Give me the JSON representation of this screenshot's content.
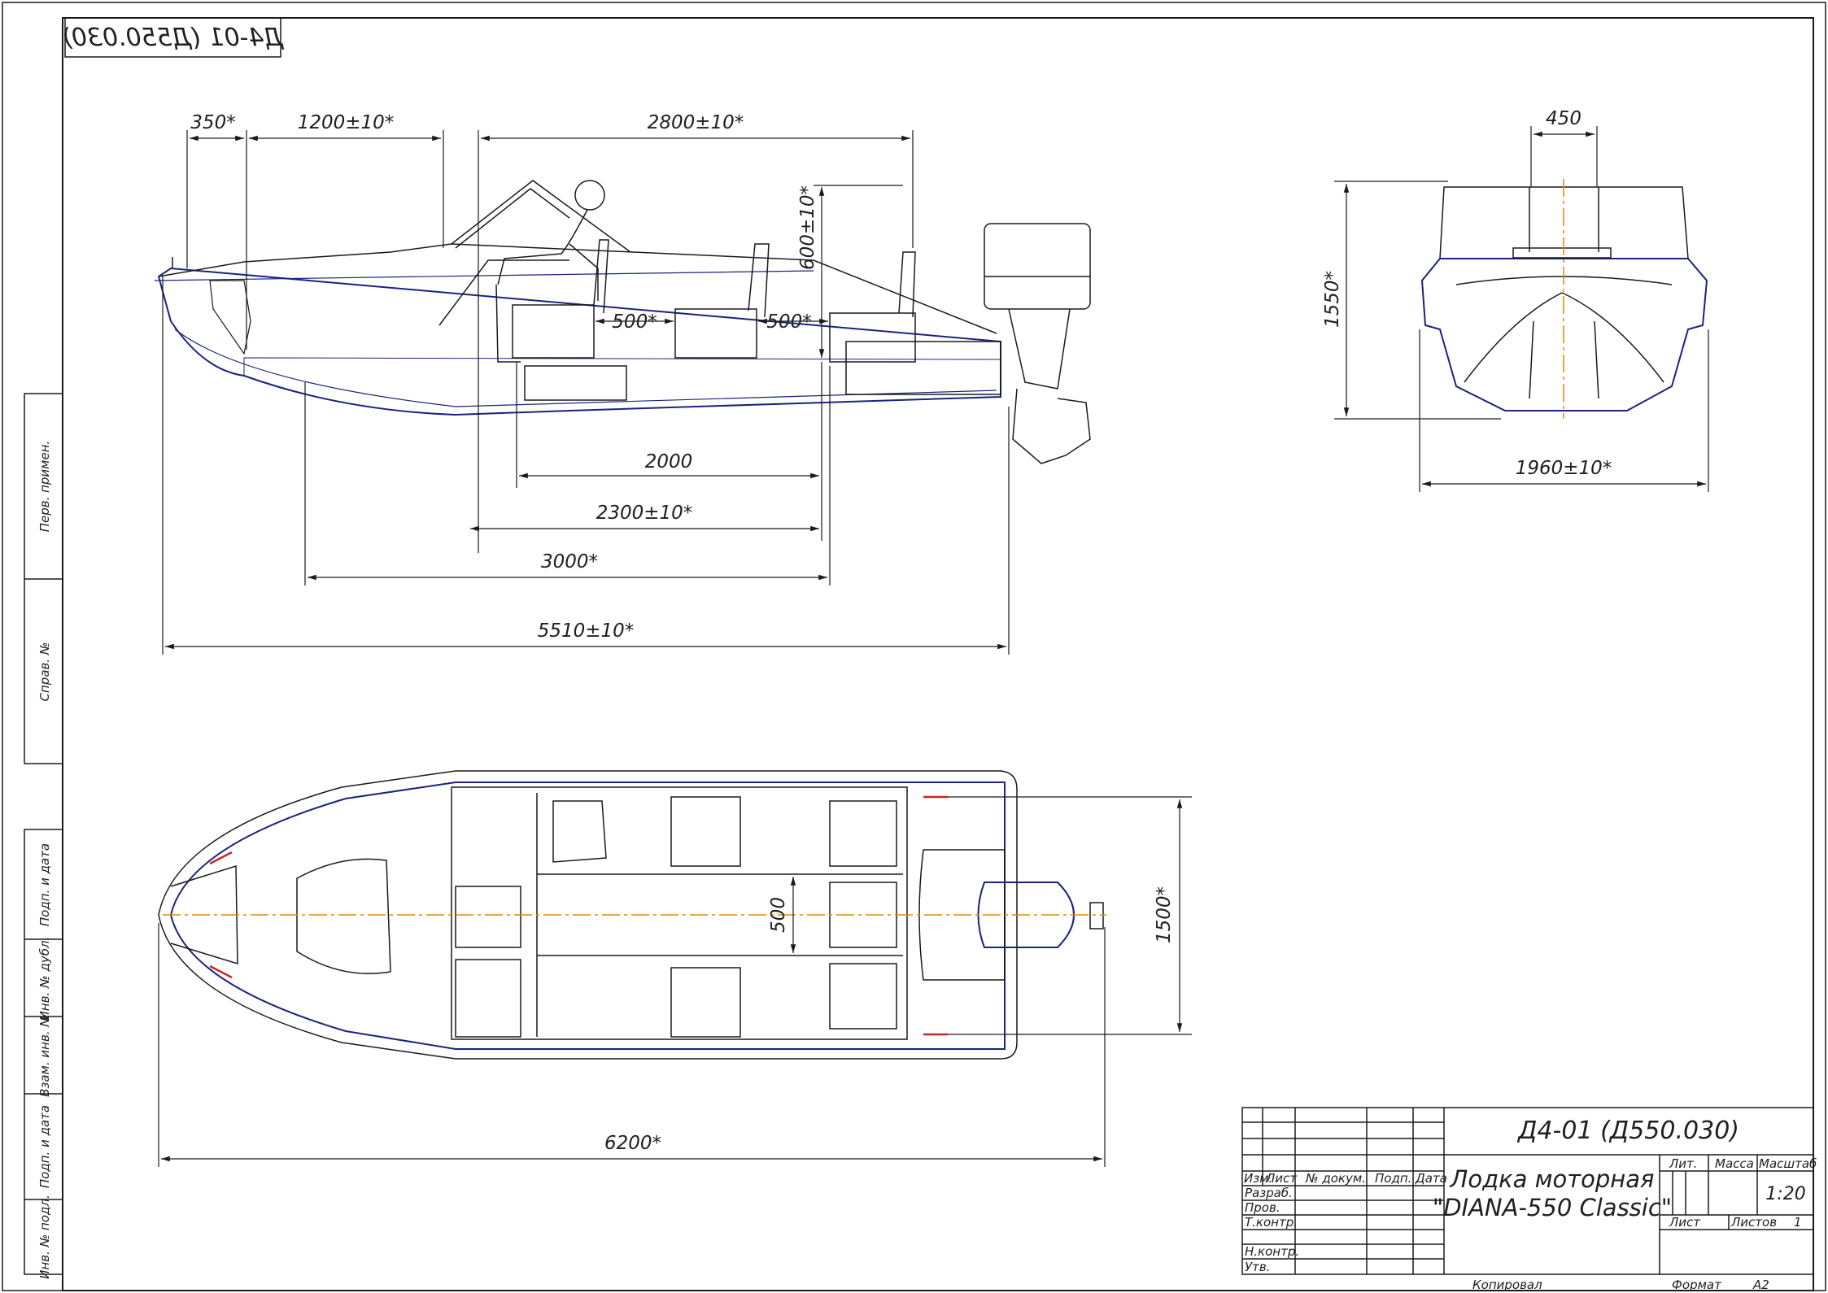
{
  "stamp": "Д4-01 (Д550.030)",
  "side_view": {
    "dims": {
      "d350": "350*",
      "d1200": "1200±10*",
      "d2800": "2800±10*",
      "d600": "600±10*",
      "d500a": "500*",
      "d500b": "500*",
      "d2000": "2000",
      "d2300": "2300±10*",
      "d3000": "3000*",
      "d5510": "5510±10*"
    }
  },
  "front_view": {
    "dims": {
      "d450": "450",
      "d1550": "1550*",
      "d1960": "1960±10*"
    }
  },
  "plan_view": {
    "dims": {
      "d500": "500",
      "d1500": "1500*",
      "d6200": "6200*"
    }
  },
  "left_margin": {
    "labels": [
      "Перв. примен.",
      "Справ. №",
      "Подп. и дата",
      "Инв. № дубл.",
      "Взам. инв. №",
      "Подп. и дата",
      "Инв. № подл."
    ]
  },
  "title_block": {
    "designation": "Д4-01 (Д550.030)",
    "name_line1": "Лодка моторная",
    "name_line2": "\"DIANA-550 Classic\"",
    "col_izm": "Изм.",
    "col_list": "Лист",
    "col_doc": "№ докум.",
    "col_podp": "Подп.",
    "col_data": "Дата",
    "row_razrab": "Разраб.",
    "row_prov": "Пров.",
    "row_tkontr": "Т.контр.",
    "row_nkontr": "Н.контр.",
    "row_utv": "Утв.",
    "lit": "Лит.",
    "massa": "Масса",
    "masshtab": "Масштаб",
    "scale_value": "1:20",
    "list_label": "Лист",
    "listov_label": "Листов",
    "listov_value": "1",
    "kopiroval": "Копировал",
    "format_label": "Формат",
    "format_value": "A2"
  },
  "colors": {
    "line": "#1a1a1a",
    "hull_blue": "#1a237e",
    "centerline": "#e08a00",
    "marker": "#c62828"
  }
}
